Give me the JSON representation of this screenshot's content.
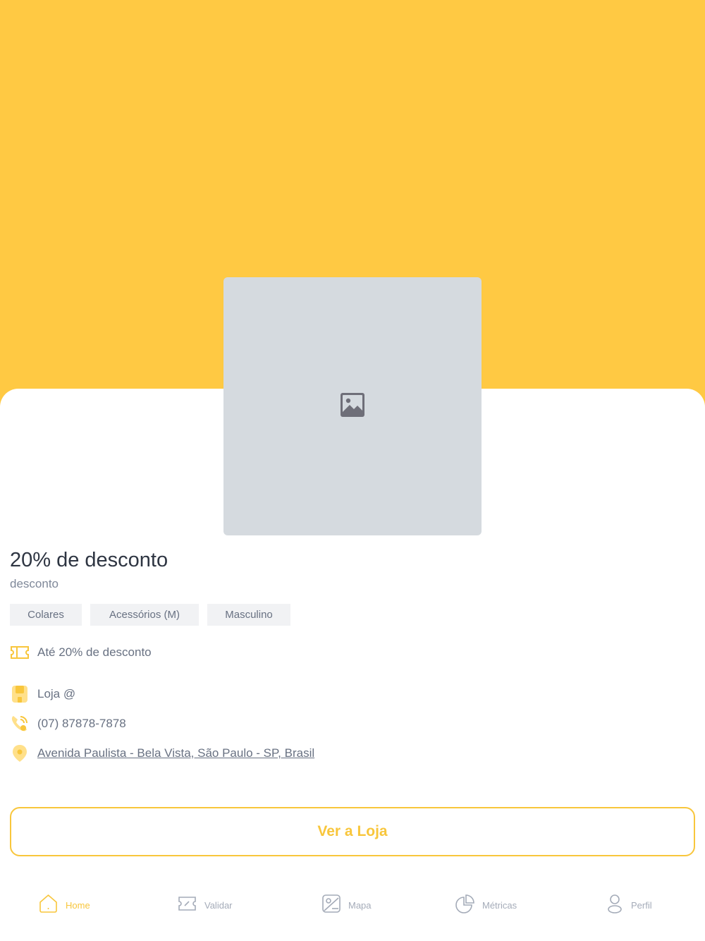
{
  "product": {
    "title": "20% de desconto",
    "subtitle": "desconto",
    "tags": [
      "Colares",
      "Acessórios (M)",
      "Masculino"
    ]
  },
  "details": {
    "discount": "Até 20% de desconto",
    "store_name": "Loja @",
    "phone": "(07) 87878-7878",
    "address": "Avenida Paulista - Bela Vista, São Paulo - SP, Brasil"
  },
  "cta": {
    "label": "Ver a Loja"
  },
  "tabbar": {
    "items": [
      {
        "label": "Home",
        "icon": "home-icon",
        "active": true
      },
      {
        "label": "Validar",
        "icon": "ticket-icon",
        "active": false
      },
      {
        "label": "Mapa",
        "icon": "map-icon",
        "active": false
      },
      {
        "label": "Métricas",
        "icon": "pie-chart-icon",
        "active": false
      },
      {
        "label": "Perfil",
        "icon": "user-icon",
        "active": false
      }
    ]
  },
  "colors": {
    "accent": "#FFC943",
    "accent_text": "#F8C63C",
    "placeholder": "#D5DADF",
    "title": "#2E3542",
    "muted": "#687182"
  }
}
